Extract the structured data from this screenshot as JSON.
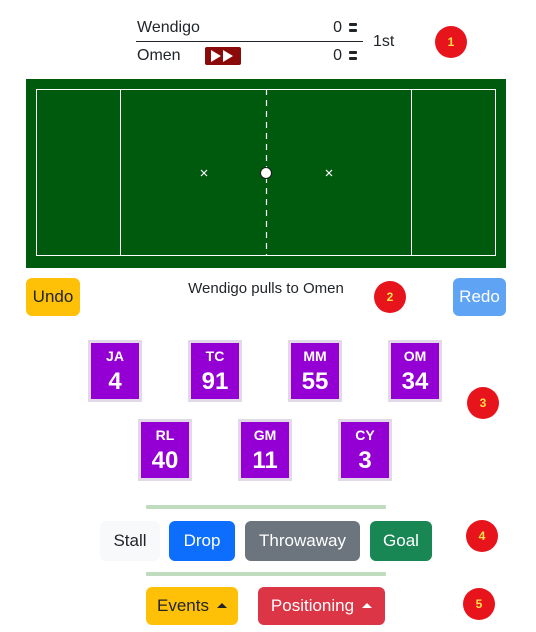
{
  "scoreboard": {
    "home": {
      "name": "Wendigo",
      "score": "0"
    },
    "away": {
      "name": "Omen",
      "score": "0"
    },
    "period": "1st",
    "fast_forward_icon": "fast-forward-icon"
  },
  "markers": [
    "1",
    "2",
    "3",
    "4",
    "5"
  ],
  "status": {
    "text": "Wendigo pulls to Omen"
  },
  "controls": {
    "undo": "Undo",
    "redo": "Redo"
  },
  "players": [
    {
      "initials": "JA",
      "number": "4"
    },
    {
      "initials": "TC",
      "number": "91"
    },
    {
      "initials": "MM",
      "number": "55"
    },
    {
      "initials": "OM",
      "number": "34"
    },
    {
      "initials": "RL",
      "number": "40"
    },
    {
      "initials": "GM",
      "number": "11"
    },
    {
      "initials": "CY",
      "number": "3"
    }
  ],
  "actions": {
    "stall": "Stall",
    "drop": "Drop",
    "throwaway": "Throwaway",
    "goal": "Goal"
  },
  "menus": {
    "events": "Events",
    "positioning": "Positioning"
  },
  "colors": {
    "field": "#005a0e",
    "player_card": "#9400d3",
    "marker": "#e8141c",
    "undo": "#ffc107",
    "redo": "#5ea3f4",
    "drop": "#0d6efd",
    "throwaway": "#6c757d",
    "goal": "#198754",
    "positioning": "#dc3545"
  }
}
